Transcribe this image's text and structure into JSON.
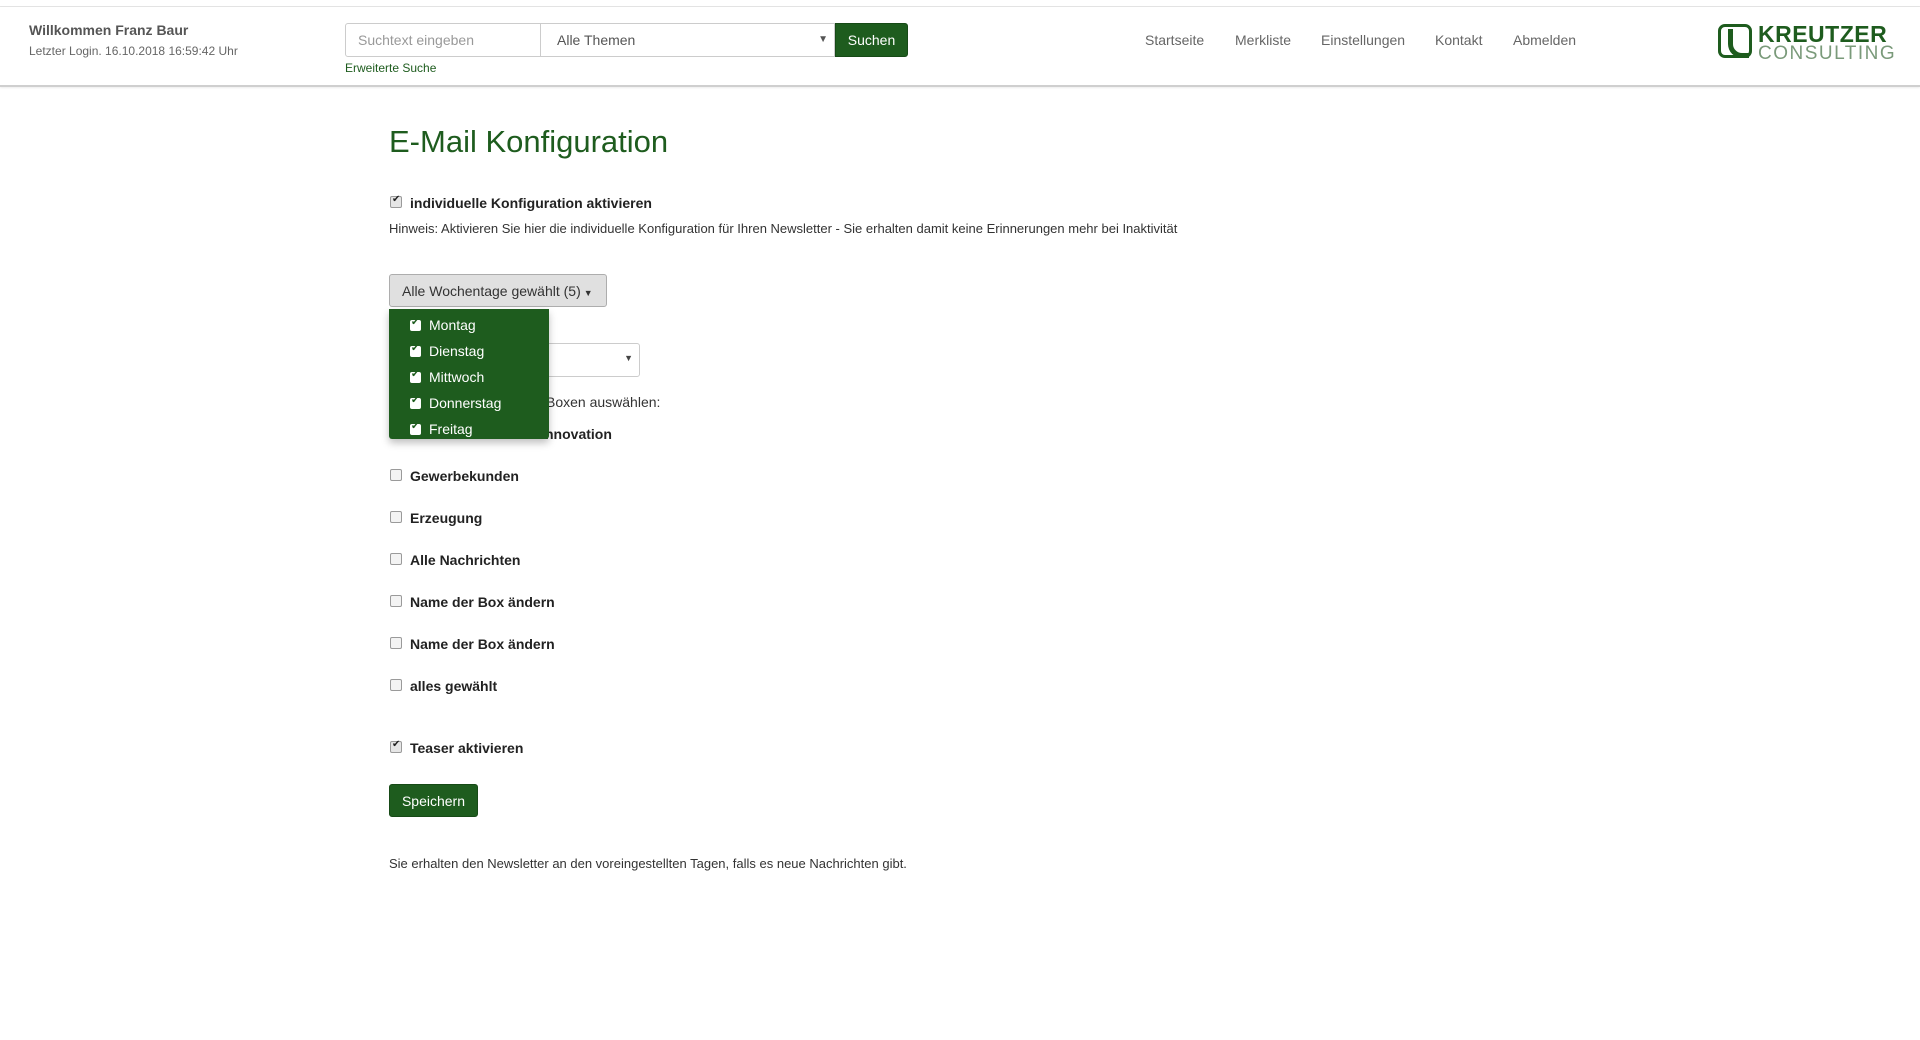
{
  "header": {
    "welcome": "Willkommen Franz Baur",
    "last_login": "Letzter Login. 16.10.2018 16:59:42 Uhr",
    "search_placeholder": "Suchtext eingeben",
    "theme_select": "Alle Themen",
    "search_button": "Suchen",
    "advanced_search": "Erweiterte Suche",
    "nav": [
      "Startseite",
      "Merkliste",
      "Einstellungen",
      "Kontakt",
      "Abmelden"
    ],
    "logo_line1": "KREUTZER",
    "logo_line2": "CONSULTING"
  },
  "main": {
    "title": "E-Mail Konfiguration",
    "individual_config_label": "individuelle Konfiguration aktivieren",
    "individual_config_checked": true,
    "hint": "Hinweis: Aktivieren Sie hier die individuelle Konfiguration für Ihren Newsletter - Sie erhalten damit keine Erinnerungen mehr bei Inaktivität",
    "weekday_button": "Alle Wochentage gewählt (5)",
    "weekdays": [
      {
        "label": "Montag",
        "checked": true
      },
      {
        "label": "Dienstag",
        "checked": true
      },
      {
        "label": "Mittwoch",
        "checked": true
      },
      {
        "label": "Donnerstag",
        "checked": true
      },
      {
        "label": "Freitag",
        "checked": true
      }
    ],
    "boxes_text_partial": "Boxen auswählen:",
    "innovation_partial": "nnovation",
    "boxes": [
      {
        "label": "Gewerbekunden",
        "checked": false
      },
      {
        "label": "Erzeugung",
        "checked": false
      },
      {
        "label": "Alle Nachrichten",
        "checked": false
      },
      {
        "label": "Name der Box ändern",
        "checked": false
      },
      {
        "label": "Name der Box ändern",
        "checked": false
      },
      {
        "label": "alles gewählt",
        "checked": false
      }
    ],
    "teaser_label": "Teaser aktivieren",
    "teaser_checked": true,
    "save_button": "Speichern",
    "footer_text": "Sie erhalten den Newsletter an den voreingestellten Tagen, falls es neue Nachrichten gibt."
  },
  "colors": {
    "brand_green": "#1e5c1e",
    "text": "#333333"
  }
}
